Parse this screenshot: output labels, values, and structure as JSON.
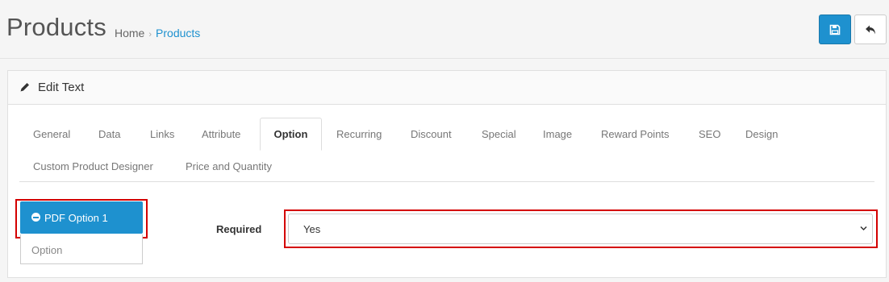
{
  "header": {
    "title": "Products",
    "breadcrumb": {
      "home": "Home",
      "separator": "›",
      "current": "Products"
    },
    "save_button_icon": "floppy-disk-icon",
    "back_button_icon": "reply-icon"
  },
  "panel": {
    "heading_icon": "pencil-icon",
    "heading": "Edit Text",
    "tabs": [
      "General",
      "Data",
      "Links",
      "Attribute",
      "Option",
      "Recurring",
      "Discount",
      "Special",
      "Image",
      "Reward Points",
      "SEO",
      "Design",
      "Custom Product Designer",
      "Price and Quantity"
    ],
    "active_tab": "Option"
  },
  "option_list": {
    "item_label": "PDF Option 1",
    "item_icon": "minus-circle-icon",
    "input_placeholder": "Option"
  },
  "form": {
    "required_label": "Required",
    "required_value": "Yes"
  },
  "colors": {
    "primary": "#1e91cf",
    "highlight": "#d40000"
  }
}
